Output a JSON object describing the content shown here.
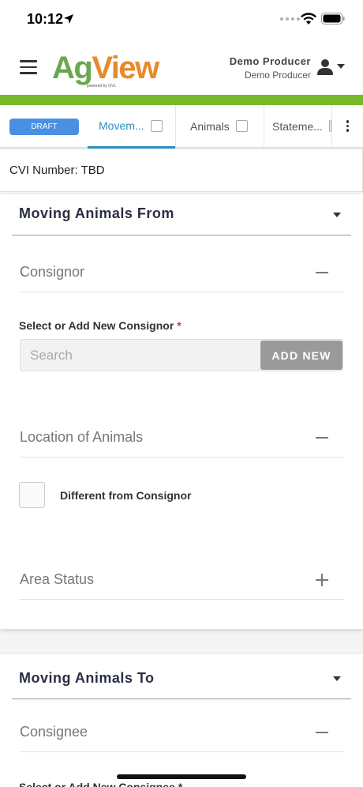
{
  "status_bar": {
    "time": "10:12"
  },
  "header": {
    "logo_ag": "Ag",
    "logo_view": "View",
    "logo_powered": "powered by GVL",
    "user_name": "Demo Producer",
    "user_org": "Demo Producer"
  },
  "tabs": {
    "draft": "DRAFT",
    "items": [
      {
        "label": "Movem..."
      },
      {
        "label": "Animals"
      },
      {
        "label": "Stateme..."
      }
    ]
  },
  "cvi": {
    "text": "CVI Number: TBD"
  },
  "moving_from": {
    "title": "Moving Animals From",
    "consignor": {
      "section": "Consignor",
      "field_label": "Select or Add New Consignor",
      "required_mark": "*",
      "search_placeholder": "Search",
      "add_new": "ADD NEW"
    },
    "location": {
      "section": "Location of Animals",
      "checkbox_label": "Different from Consignor"
    },
    "area_status": {
      "section": "Area Status"
    }
  },
  "moving_to": {
    "title": "Moving Animals To",
    "consignee": {
      "section": "Consignee",
      "field_label_partial": "Select or Add New Consignee *"
    }
  }
}
